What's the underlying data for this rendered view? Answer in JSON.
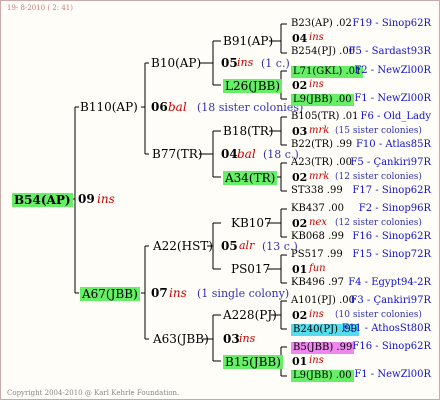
{
  "header": {
    "date": "19-  8-2010 (  2: 41)"
  },
  "footer": {
    "copyright": "Copyright 2004-2010 @ Karl Kehrle Foundation."
  },
  "root": {
    "label": "B54(AP)",
    "gen": "09",
    "note": "ins"
  },
  "g1": {
    "upper": {
      "label": "B110(AP)",
      "gen": "06",
      "note": "bal",
      "sis": "(18 sister colonies)"
    },
    "lower": {
      "label": "A67(JBB)",
      "gen": "07",
      "note": "ins",
      "sis": "(1 single colony)"
    }
  },
  "g2": {
    "b10": {
      "label": "B10(AP)",
      "gen": "05",
      "note": "ins",
      "sis": "(1 c.)"
    },
    "b77": {
      "label": "B77(TR)",
      "gen": "04",
      "note": "bal",
      "sis": "(18 c.)"
    },
    "a22": {
      "label": "A22(HST)",
      "gen": "05",
      "note": "alr",
      "sis": "(13 c.)"
    },
    "a63": {
      "label": "A63(JBB)",
      "gen": "03",
      "note": "ins"
    }
  },
  "g3": {
    "b91": "B91(AP)",
    "l26": "L26(JBB)",
    "b18": "B18(TR)",
    "a34": "A34(TR)",
    "kb107": "KB107",
    "ps017": "PS017",
    "a228": "A228(PJ)",
    "b15": "B15(JBB)"
  },
  "g4": [
    {
      "top": "B23(AP) .02",
      "topr": "F19 - Sinop62R",
      "gen": "04",
      "note": "ins",
      "sis": "",
      "bot": "B254(PJ) .00",
      "botr": "F5 - Sardast93R"
    },
    {
      "top": "L71(GKL) .01",
      "topr": "F2 - NewZl00R",
      "gen": "02",
      "note": "ins",
      "sis": "",
      "bot": "L9(JBB) .00",
      "botr": "F1 - NewZl00R"
    },
    {
      "top": "B105(TR) .01",
      "topr": "F6 - Old_Lady",
      "gen": "03",
      "note": "mrk",
      "sis": "(15 sister colonies)",
      "bot": "B22(TR) .99",
      "botr": "F10 - Atlas85R"
    },
    {
      "top": "A23(TR) .00",
      "topr": "F5 - Çankiri97R",
      "gen": "02",
      "note": "mrk",
      "sis": "(12 sister colonies)",
      "bot": "ST338 .99",
      "botr": "F17 - Sinop62R"
    },
    {
      "top": "KB437 .00",
      "topr": "F2 - Sinop96R",
      "gen": "02",
      "note": "nex",
      "sis": "(12 sister colonies)",
      "bot": "KB068 .99",
      "botr": "F16 - Sinop62R"
    },
    {
      "top": "PS517 .99",
      "topr": "F15 - Sinop72R",
      "gen": "01",
      "note": "fun",
      "sis": "",
      "bot": "KB496 .97",
      "botr": "F4 - Egypt94-2R"
    },
    {
      "top": "A101(PJ) .00",
      "topr": "F3 - Çankiri97R",
      "gen": "02",
      "note": "ins",
      "sis": "(10 sister colonies)",
      "bot": "B240(PJ) .99",
      "botr": "F11 - AthosSt80R"
    },
    {
      "top": "B5(JBB) .99",
      "topr": "F16 - Sinop62R",
      "gen": "01",
      "note": "ins",
      "sis": "",
      "bot": "L9(JBB) .00",
      "botr": "F1 - NewZl00R"
    }
  ]
}
